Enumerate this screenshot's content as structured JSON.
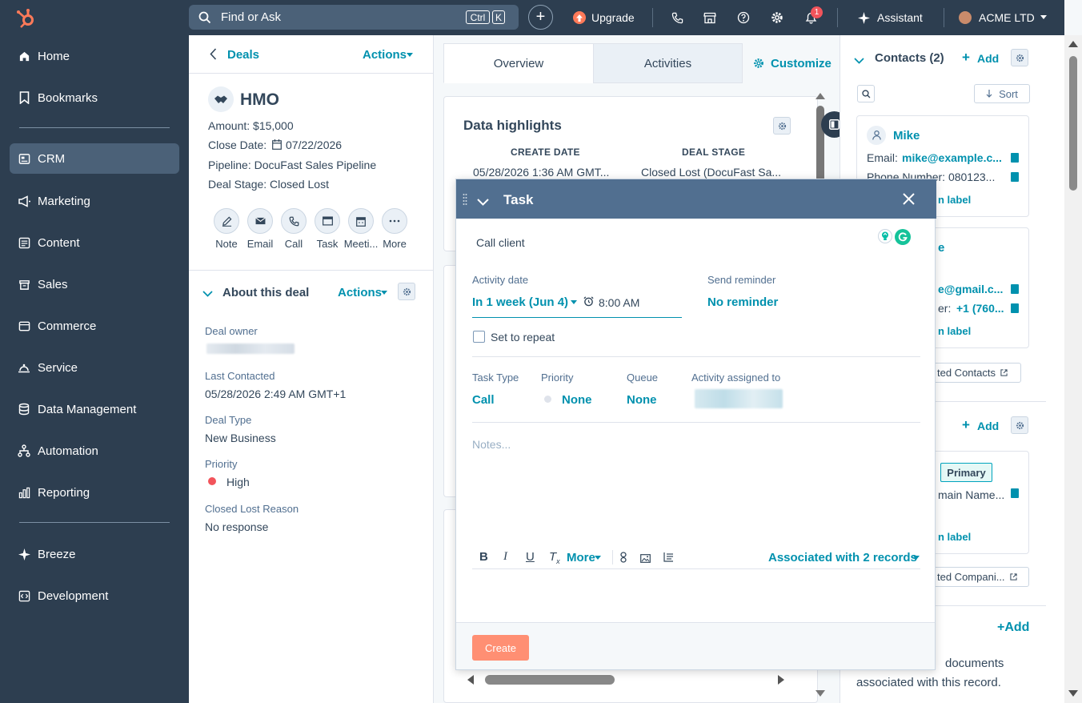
{
  "nav": {
    "items": [
      {
        "label": "Home",
        "icon": "home-icon"
      },
      {
        "label": "Bookmarks",
        "icon": "bookmark-icon"
      },
      {
        "label": "CRM",
        "icon": "crm-icon"
      },
      {
        "label": "Marketing",
        "icon": "megaphone-icon"
      },
      {
        "label": "Content",
        "icon": "content-icon"
      },
      {
        "label": "Sales",
        "icon": "sales-icon"
      },
      {
        "label": "Commerce",
        "icon": "commerce-icon"
      },
      {
        "label": "Service",
        "icon": "service-icon"
      },
      {
        "label": "Data Management",
        "icon": "database-icon"
      },
      {
        "label": "Automation",
        "icon": "automation-icon"
      },
      {
        "label": "Reporting",
        "icon": "chart-icon"
      },
      {
        "label": "Breeze",
        "icon": "sparkle-icon"
      },
      {
        "label": "Development",
        "icon": "code-icon"
      }
    ],
    "active": "CRM"
  },
  "topbar": {
    "search_placeholder": "Find or Ask",
    "kbd_ctrl": "Ctrl",
    "kbd_k": "K",
    "upgrade": "Upgrade",
    "notif_count": "1",
    "assistant": "Assistant",
    "account": "ACME LTD"
  },
  "deal": {
    "back": "Deals",
    "actions": "Actions",
    "name": "HMO",
    "amount": "Amount: $15,000",
    "close_date_label": "Close Date:",
    "close_date": "07/22/2026",
    "pipeline": "Pipeline: DocuFast Sales Pipeline",
    "stage": "Deal Stage: Closed Lost",
    "activity_buttons": [
      "Note",
      "Email",
      "Call",
      "Task",
      "Meeti...",
      "More"
    ]
  },
  "about": {
    "title": "About this deal",
    "actions": "Actions",
    "fields": [
      {
        "label": "Deal owner",
        "value": ""
      },
      {
        "label": "Last Contacted",
        "value": "05/28/2026 2:49 AM GMT+1"
      },
      {
        "label": "Deal Type",
        "value": "New Business"
      },
      {
        "label": "Priority",
        "value": "High"
      },
      {
        "label": "Closed Lost Reason",
        "value": "No response"
      }
    ]
  },
  "middle": {
    "tabs": [
      "Overview",
      "Activities"
    ],
    "customize": "Customize",
    "highlights_title": "Data highlights",
    "col1_header": "CREATE DATE",
    "col1_value": "05/28/2026 1:36 AM GMT...",
    "col2_header": "DEAL STAGE",
    "col2_value": "Closed Lost (DocuFast Sa..."
  },
  "right": {
    "contacts_title": "Contacts (2)",
    "add": "Add",
    "sort": "Sort",
    "contact1_name": "Mike",
    "contact1_email_label": "Email:",
    "contact1_email": "mike@example.c...",
    "contact1_phone": "Phone Number: 080123...",
    "label_link": "n label",
    "contact2_name_frag": "e",
    "contact2_email_frag": "e@gmail.c...",
    "contact2_phone_label": "er:",
    "contact2_phone": "+1 (760...",
    "view_contacts": "ted Contacts",
    "companies_add": "Add",
    "primary": "Primary",
    "domain_frag": "main Name...",
    "view_companies": "ted Compani...",
    "attach_add": "+Add",
    "attach_text_1": "documents",
    "attach_text_2": "associated with this record."
  },
  "task": {
    "title": "Task",
    "task_name": "Call client",
    "activity_date_label": "Activity date",
    "activity_date": "In 1 week (Jun 4)",
    "time": "8:00 AM",
    "send_reminder_label": "Send reminder",
    "send_reminder": "No reminder",
    "repeat": "Set to repeat",
    "type_label": "Task Type",
    "type": "Call",
    "priority_label": "Priority",
    "priority": "None",
    "queue_label": "Queue",
    "queue": "None",
    "assigned_label": "Activity assigned to",
    "notes_placeholder": "Notes...",
    "more": "More",
    "associated": "Associated with 2 records",
    "create": "Create"
  },
  "colors": {
    "nav_bg": "#2d3e50",
    "accent": "#0091ae",
    "task_header": "#516f90",
    "create_btn": "#ff8f73",
    "priority_high": "#f2545b"
  }
}
